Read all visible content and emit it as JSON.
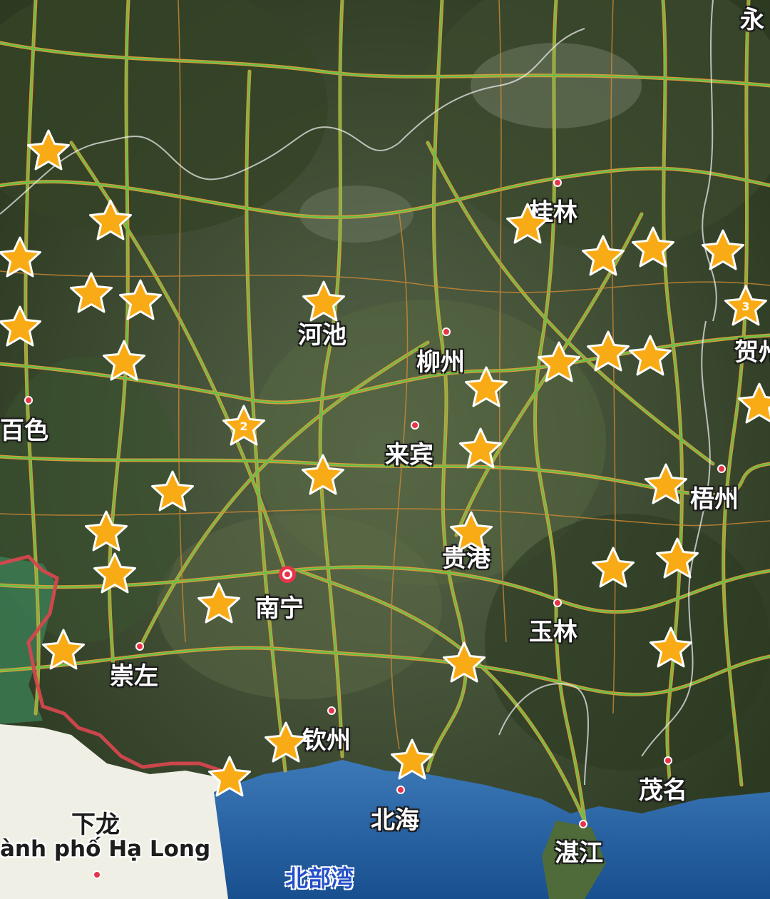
{
  "map": {
    "labels": [
      {
        "id": "guilin",
        "text": "桂林"
      },
      {
        "id": "hechi",
        "text": "河池"
      },
      {
        "id": "liuzhou",
        "text": "柳州"
      },
      {
        "id": "baise",
        "text": "百色"
      },
      {
        "id": "laibin",
        "text": "来宾"
      },
      {
        "id": "wuzhou",
        "text": "梧州"
      },
      {
        "id": "guigang",
        "text": "贵港"
      },
      {
        "id": "nanning",
        "text": "南宁"
      },
      {
        "id": "yulin",
        "text": "玉林"
      },
      {
        "id": "chongzuo",
        "text": "崇左"
      },
      {
        "id": "qinzhou",
        "text": "钦州"
      },
      {
        "id": "maoming",
        "text": "茂名"
      },
      {
        "id": "beihai",
        "text": "北海"
      },
      {
        "id": "zhanjiang",
        "text": "湛江"
      },
      {
        "id": "hezhou",
        "text": "贺州"
      },
      {
        "id": "yong",
        "text": "永"
      },
      {
        "id": "xialong",
        "text": "下龙"
      },
      {
        "id": "halong",
        "text": "ành phố Hạ Long"
      },
      {
        "id": "beibuwan",
        "text": "北部湾"
      }
    ],
    "clusters": [
      {
        "id": "c2",
        "count": "2"
      },
      {
        "id": "c3",
        "count": "3"
      }
    ],
    "marker_icon": "star-icon",
    "colors": {
      "marker": "#f9ab16",
      "highway": "#5fc24a",
      "road": "#e9a23b",
      "border": "#d4474d",
      "sea": "#1f5fa8",
      "land_foreign": "#efefe6"
    }
  }
}
